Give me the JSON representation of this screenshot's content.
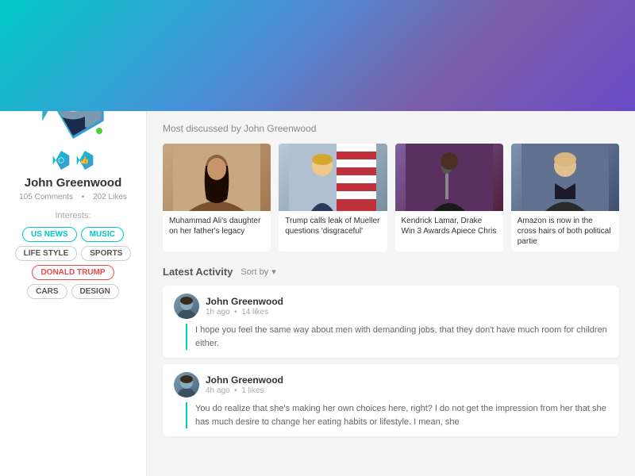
{
  "header": {
    "banner_gradient": "linear-gradient(135deg, #00c9c8 0%, #4a90d9 40%, #7b5ea7 70%, #6a4bc9 100%)"
  },
  "sidebar": {
    "profile_name": "John Greenwood",
    "comments": "105 Comments",
    "dot": "•",
    "likes": "202 Likes",
    "interests_label": "Interests:",
    "interests": [
      {
        "label": "US NEWS",
        "style": "active-teal"
      },
      {
        "label": "MUSIC",
        "style": "active-teal"
      },
      {
        "label": "LIFE STYLE",
        "style": "normal"
      },
      {
        "label": "SPORTS",
        "style": "normal"
      },
      {
        "label": "DONALD TRUMP",
        "style": "active-red"
      },
      {
        "label": "CARS",
        "style": "normal"
      },
      {
        "label": "DESIGN",
        "style": "normal"
      }
    ]
  },
  "main": {
    "most_discussed_title": "Most discussed by John Greenwood",
    "news_cards": [
      {
        "img_class": "img-ali",
        "text": "Muhammad Ali's daughter on her father's legacy"
      },
      {
        "img_class": "img-trump",
        "text": "Trump calls leak of Mueller questions 'disgraceful'"
      },
      {
        "img_class": "img-kendrick",
        "text": "Kendrick Lamar, Drake Win 3 Awards Apiece Chris"
      },
      {
        "img_class": "img-bezos",
        "text": "Amazon is now in the cross hairs of both political partie"
      }
    ],
    "latest_activity_title": "Latest Activity",
    "sort_by_label": "Sort by",
    "activities": [
      {
        "user": "John Greenwood",
        "meta": "1h ago  •  14 likes",
        "text": "I hope you feel the same way about men with demanding jobs, that they don't have much room for children either."
      },
      {
        "user": "John Greenwood",
        "meta": "4h ago  •  1 likes",
        "text": "You do realize that she's making her own choices here, right?  I do not get the impression from her that she has much desire to change her eating habits or lifestyle.  I mean, she"
      }
    ]
  }
}
